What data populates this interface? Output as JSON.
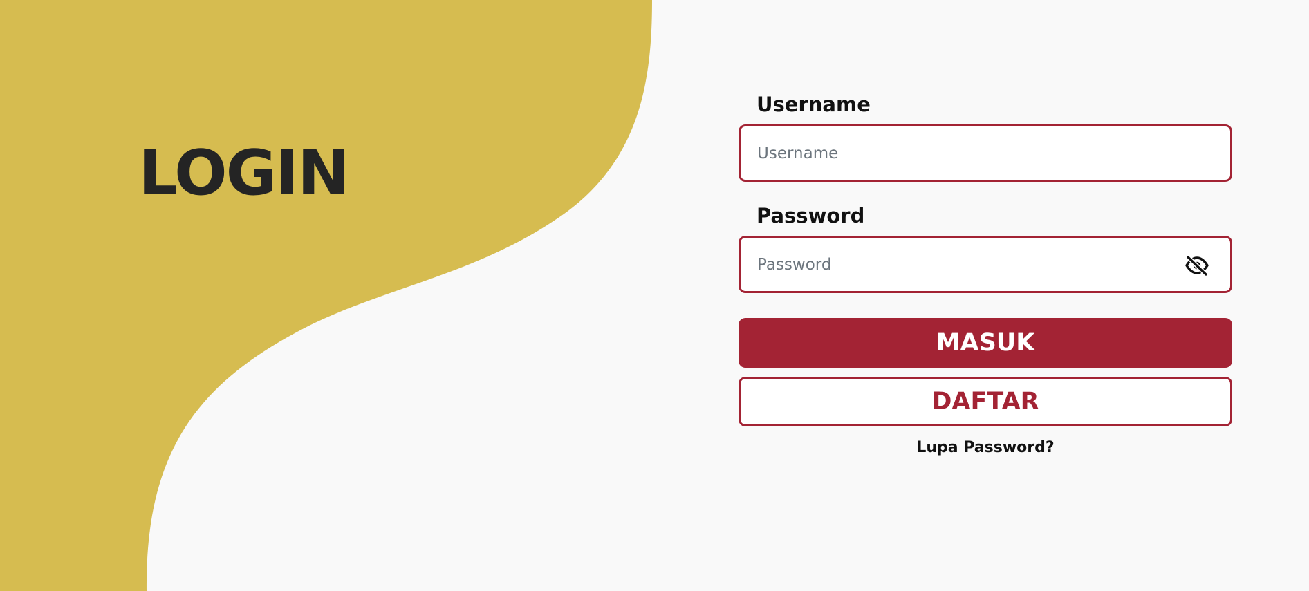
{
  "colors": {
    "background": "#f9f9f9",
    "wave": "#d6bc50",
    "accent": "#a32334",
    "title": "#242424"
  },
  "hero": {
    "title": "LOGIN"
  },
  "form": {
    "username": {
      "label": "Username",
      "placeholder": "Username",
      "value": ""
    },
    "password": {
      "label": "Password",
      "placeholder": "Password",
      "value": "",
      "toggle_icon": "eye-slash-icon"
    },
    "submit_label": "MASUK",
    "register_label": "DAFTAR",
    "forgot_label": "Lupa Password?"
  }
}
